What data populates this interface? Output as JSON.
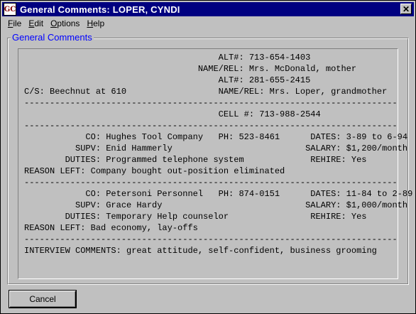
{
  "window": {
    "title": "General Comments:  LOPER, CYNDI",
    "icon_glyph": "GC",
    "close_glyph": "✕"
  },
  "menu": {
    "items": [
      {
        "label": "File",
        "mnemonic": "F"
      },
      {
        "label": "Edit",
        "mnemonic": "E"
      },
      {
        "label": "Options",
        "mnemonic": "O"
      },
      {
        "label": "Help",
        "mnemonic": "H"
      }
    ]
  },
  "group": {
    "legend": "General Comments"
  },
  "comments": {
    "lines": [
      "                                      ALT#: 713-654-1403",
      "                                  NAME/REL: Mrs. McDonald, mother",
      "                                      ALT#: 281-655-2415",
      "C/S: Beechnut at 610                  NAME/REL: Mrs. Loper, grandmother",
      "-------------------------------------------------------------------------",
      "                                      CELL #: 713-988-2544",
      "-------------------------------------------------------------------------",
      "            CO: Hughes Tool Company   PH: 523-8461      DATES: 3-89 to 6-94",
      "          SUPV: Enid Hammerly                          SALARY: $1,200/month",
      "        DUTIES: Programmed telephone system             REHIRE: Yes",
      "REASON LEFT: Company bought out-position eliminated",
      "-------------------------------------------------------------------------",
      "            CO: Petersoni Personnel   PH: 874-0151      DATES: 11-84 to 2-89",
      "          SUPV: Grace Hardy                            SALARY: $1,000/month",
      "        DUTIES: Temporary Help counselor                REHIRE: Yes",
      "REASON LEFT: Bad economy, lay-offs",
      "-------------------------------------------------------------------------",
      "INTERVIEW COMMENTS: great attitude, self-confident, business grooming"
    ]
  },
  "buttons": {
    "cancel_label": "Cancel"
  }
}
